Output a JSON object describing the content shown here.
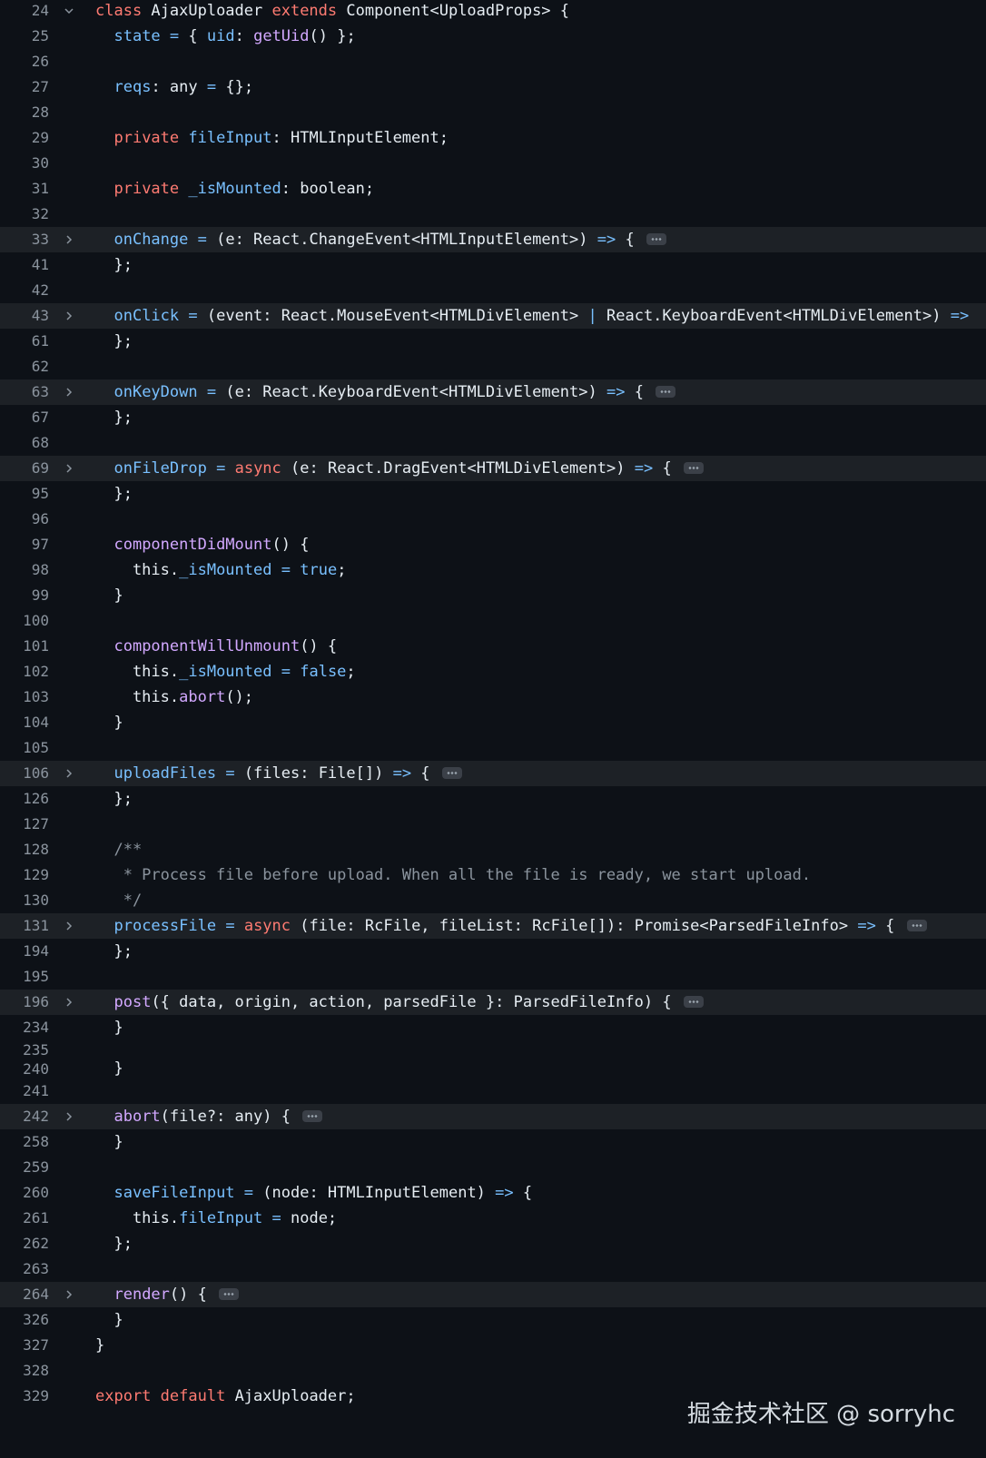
{
  "colors": {
    "keyword": "#ff7b72",
    "function": "#d2a8ff",
    "property": "#79c0ff",
    "plain": "#e6edf3",
    "comment": "#8b949e",
    "background": "#0d1117",
    "folded_row": "#1d2126"
  },
  "icons": {
    "expanded": "chevron-down-icon",
    "collapsed": "chevron-right-icon",
    "folded_placeholder": "ellipsis-icon"
  },
  "lines": [
    {
      "n": "24",
      "fold": "open",
      "tokens": [
        [
          "class",
          "keyword"
        ],
        [
          " AjaxUploader ",
          "plain"
        ],
        [
          "extends",
          "keyword"
        ],
        [
          " Component<UploadProps> {",
          "plain"
        ]
      ]
    },
    {
      "n": "25",
      "tokens": [
        [
          "  ",
          "plain"
        ],
        [
          "state",
          "property"
        ],
        [
          " ",
          "plain"
        ],
        [
          "=",
          "property"
        ],
        [
          " { ",
          "plain"
        ],
        [
          "uid",
          "property"
        ],
        [
          ": ",
          "plain"
        ],
        [
          "getUid",
          "function"
        ],
        [
          "() };",
          "plain"
        ]
      ]
    },
    {
      "n": "26",
      "tokens": []
    },
    {
      "n": "27",
      "tokens": [
        [
          "  ",
          "plain"
        ],
        [
          "reqs",
          "property"
        ],
        [
          ": any ",
          "plain"
        ],
        [
          "=",
          "property"
        ],
        [
          " {};",
          "plain"
        ]
      ]
    },
    {
      "n": "28",
      "tokens": []
    },
    {
      "n": "29",
      "tokens": [
        [
          "  ",
          "plain"
        ],
        [
          "private",
          "keyword"
        ],
        [
          " ",
          "plain"
        ],
        [
          "fileInput",
          "property"
        ],
        [
          ": HTMLInputElement;",
          "plain"
        ]
      ]
    },
    {
      "n": "30",
      "tokens": []
    },
    {
      "n": "31",
      "tokens": [
        [
          "  ",
          "plain"
        ],
        [
          "private",
          "keyword"
        ],
        [
          " ",
          "plain"
        ],
        [
          "_isMounted",
          "property"
        ],
        [
          ": boolean;",
          "plain"
        ]
      ]
    },
    {
      "n": "32",
      "tokens": []
    },
    {
      "n": "33",
      "fold": "closed",
      "dots": true,
      "tokens": [
        [
          "  ",
          "plain"
        ],
        [
          "onChange",
          "property"
        ],
        [
          " ",
          "plain"
        ],
        [
          "=",
          "property"
        ],
        [
          " (e: React.ChangeEvent<HTMLInputElement>) ",
          "plain"
        ],
        [
          "=>",
          "property"
        ],
        [
          " {",
          "plain"
        ]
      ]
    },
    {
      "n": "41",
      "tokens": [
        [
          "  };",
          "plain"
        ]
      ]
    },
    {
      "n": "42",
      "tokens": []
    },
    {
      "n": "43",
      "fold": "closed",
      "tokens": [
        [
          "  ",
          "plain"
        ],
        [
          "onClick",
          "property"
        ],
        [
          " ",
          "plain"
        ],
        [
          "=",
          "property"
        ],
        [
          " (event: React.MouseEvent<HTMLDivElement> ",
          "plain"
        ],
        [
          "|",
          "property"
        ],
        [
          " React.KeyboardEvent<HTMLDivElement>) ",
          "plain"
        ],
        [
          "=>",
          "property"
        ]
      ]
    },
    {
      "n": "61",
      "tokens": [
        [
          "  };",
          "plain"
        ]
      ]
    },
    {
      "n": "62",
      "tokens": []
    },
    {
      "n": "63",
      "fold": "closed",
      "dots": true,
      "tokens": [
        [
          "  ",
          "plain"
        ],
        [
          "onKeyDown",
          "property"
        ],
        [
          " ",
          "plain"
        ],
        [
          "=",
          "property"
        ],
        [
          " (e: React.KeyboardEvent<HTMLDivElement>) ",
          "plain"
        ],
        [
          "=>",
          "property"
        ],
        [
          " {",
          "plain"
        ]
      ]
    },
    {
      "n": "67",
      "tokens": [
        [
          "  };",
          "plain"
        ]
      ]
    },
    {
      "n": "68",
      "tokens": []
    },
    {
      "n": "69",
      "fold": "closed",
      "dots": true,
      "tokens": [
        [
          "  ",
          "plain"
        ],
        [
          "onFileDrop",
          "property"
        ],
        [
          " ",
          "plain"
        ],
        [
          "=",
          "property"
        ],
        [
          " ",
          "plain"
        ],
        [
          "async",
          "keyword"
        ],
        [
          " (e: React.DragEvent<HTMLDivElement>) ",
          "plain"
        ],
        [
          "=>",
          "property"
        ],
        [
          " {",
          "plain"
        ]
      ]
    },
    {
      "n": "95",
      "tokens": [
        [
          "  };",
          "plain"
        ]
      ]
    },
    {
      "n": "96",
      "tokens": []
    },
    {
      "n": "97",
      "tokens": [
        [
          "  ",
          "plain"
        ],
        [
          "componentDidMount",
          "function"
        ],
        [
          "() {",
          "plain"
        ]
      ]
    },
    {
      "n": "98",
      "tokens": [
        [
          "    this.",
          "plain"
        ],
        [
          "_isMounted",
          "property"
        ],
        [
          " ",
          "plain"
        ],
        [
          "=",
          "property"
        ],
        [
          " ",
          "plain"
        ],
        [
          "true",
          "property"
        ],
        [
          ";",
          "plain"
        ]
      ]
    },
    {
      "n": "99",
      "tokens": [
        [
          "  }",
          "plain"
        ]
      ]
    },
    {
      "n": "100",
      "tokens": []
    },
    {
      "n": "101",
      "tokens": [
        [
          "  ",
          "plain"
        ],
        [
          "componentWillUnmount",
          "function"
        ],
        [
          "() {",
          "plain"
        ]
      ]
    },
    {
      "n": "102",
      "tokens": [
        [
          "    this.",
          "plain"
        ],
        [
          "_isMounted",
          "property"
        ],
        [
          " ",
          "plain"
        ],
        [
          "=",
          "property"
        ],
        [
          " ",
          "plain"
        ],
        [
          "false",
          "property"
        ],
        [
          ";",
          "plain"
        ]
      ]
    },
    {
      "n": "103",
      "tokens": [
        [
          "    this.",
          "plain"
        ],
        [
          "abort",
          "function"
        ],
        [
          "();",
          "plain"
        ]
      ]
    },
    {
      "n": "104",
      "tokens": [
        [
          "  }",
          "plain"
        ]
      ]
    },
    {
      "n": "105",
      "tokens": []
    },
    {
      "n": "106",
      "fold": "closed",
      "dots": true,
      "tokens": [
        [
          "  ",
          "plain"
        ],
        [
          "uploadFiles",
          "property"
        ],
        [
          " ",
          "plain"
        ],
        [
          "=",
          "property"
        ],
        [
          " (files: File[]) ",
          "plain"
        ],
        [
          "=>",
          "property"
        ],
        [
          " {",
          "plain"
        ]
      ]
    },
    {
      "n": "126",
      "tokens": [
        [
          "  };",
          "plain"
        ]
      ]
    },
    {
      "n": "127",
      "tokens": []
    },
    {
      "n": "128",
      "tokens": [
        [
          "  /**",
          "comment"
        ]
      ]
    },
    {
      "n": "129",
      "tokens": [
        [
          "   * Process file before upload. When all the file is ready, we start upload.",
          "comment"
        ]
      ]
    },
    {
      "n": "130",
      "tokens": [
        [
          "   */",
          "comment"
        ]
      ]
    },
    {
      "n": "131",
      "fold": "closed",
      "dots": true,
      "tokens": [
        [
          "  ",
          "plain"
        ],
        [
          "processFile",
          "property"
        ],
        [
          " ",
          "plain"
        ],
        [
          "=",
          "property"
        ],
        [
          " ",
          "plain"
        ],
        [
          "async",
          "keyword"
        ],
        [
          " (file: RcFile, fileList: RcFile[]): Promise<ParsedFileInfo> ",
          "plain"
        ],
        [
          "=>",
          "property"
        ],
        [
          " {",
          "plain"
        ]
      ]
    },
    {
      "n": "194",
      "tokens": [
        [
          "  };",
          "plain"
        ]
      ]
    },
    {
      "n": "195",
      "tokens": []
    },
    {
      "n": "196",
      "fold": "closed",
      "dots": true,
      "tokens": [
        [
          "  ",
          "plain"
        ],
        [
          "post",
          "function"
        ],
        [
          "({ data, origin, action, parsedFile }: ParsedFileInfo) {",
          "plain"
        ]
      ]
    },
    {
      "n": "234",
      "tokens": [
        [
          "  }",
          "plain"
        ]
      ]
    },
    {
      "n": "235",
      "short": true,
      "tokens": []
    },
    {
      "n": "240",
      "short": true,
      "tokens": [
        [
          "  }",
          "plain"
        ]
      ]
    },
    {
      "n": "241",
      "tokens": []
    },
    {
      "n": "242",
      "fold": "closed",
      "dots": true,
      "tokens": [
        [
          "  ",
          "plain"
        ],
        [
          "abort",
          "function"
        ],
        [
          "(file?: any) {",
          "plain"
        ]
      ]
    },
    {
      "n": "258",
      "tokens": [
        [
          "  }",
          "plain"
        ]
      ]
    },
    {
      "n": "259",
      "tokens": []
    },
    {
      "n": "260",
      "tokens": [
        [
          "  ",
          "plain"
        ],
        [
          "saveFileInput",
          "property"
        ],
        [
          " ",
          "plain"
        ],
        [
          "=",
          "property"
        ],
        [
          " (node: HTMLInputElement) ",
          "plain"
        ],
        [
          "=>",
          "property"
        ],
        [
          " {",
          "plain"
        ]
      ]
    },
    {
      "n": "261",
      "tokens": [
        [
          "    this.",
          "plain"
        ],
        [
          "fileInput",
          "property"
        ],
        [
          " ",
          "plain"
        ],
        [
          "=",
          "property"
        ],
        [
          " node;",
          "plain"
        ]
      ]
    },
    {
      "n": "262",
      "tokens": [
        [
          "  };",
          "plain"
        ]
      ]
    },
    {
      "n": "263",
      "tokens": []
    },
    {
      "n": "264",
      "fold": "closed",
      "dots": true,
      "tokens": [
        [
          "  ",
          "plain"
        ],
        [
          "render",
          "function"
        ],
        [
          "() {",
          "plain"
        ]
      ]
    },
    {
      "n": "326",
      "tokens": [
        [
          "  }",
          "plain"
        ]
      ]
    },
    {
      "n": "327",
      "tokens": [
        [
          "}",
          "plain"
        ]
      ]
    },
    {
      "n": "328",
      "tokens": []
    },
    {
      "n": "329",
      "tokens": [
        [
          "export",
          "keyword"
        ],
        [
          " ",
          "plain"
        ],
        [
          "default",
          "keyword"
        ],
        [
          " AjaxUploader;",
          "plain"
        ]
      ]
    }
  ],
  "watermark": "掘金技术社区 @ sorryhc"
}
